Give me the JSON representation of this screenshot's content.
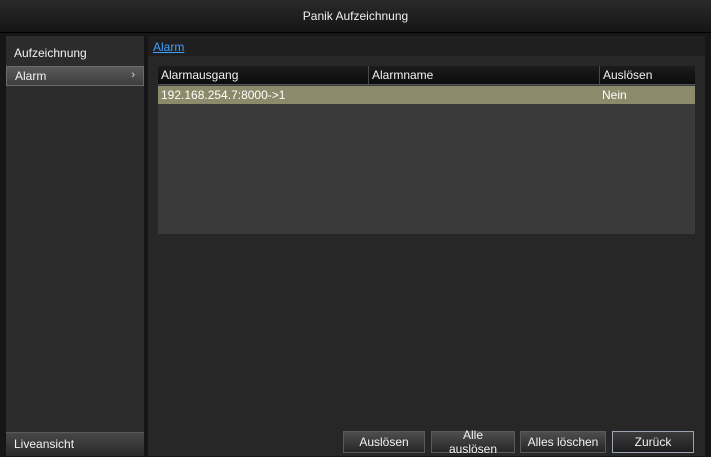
{
  "window": {
    "title": "Panik Aufzeichnung"
  },
  "sidebar": {
    "items": [
      {
        "label": "Aufzeichnung"
      },
      {
        "label": "Alarm",
        "chevron": "›"
      }
    ],
    "bottom_label": "Liveansicht"
  },
  "main": {
    "breadcrumb": "Alarm",
    "table": {
      "headers": [
        "Alarmausgang",
        "Alarmname",
        "Auslösen"
      ],
      "rows": [
        [
          "192.168.254.7:8000->1",
          "",
          "Nein"
        ]
      ]
    }
  },
  "buttons": {
    "trigger": "Auslösen",
    "trigger_all": "Alle auslösen",
    "clear_all": "Alles löschen",
    "back": "Zurück"
  },
  "colors": {
    "accent_link": "#3fa0ff",
    "selected_row": "#8b8a6b"
  }
}
